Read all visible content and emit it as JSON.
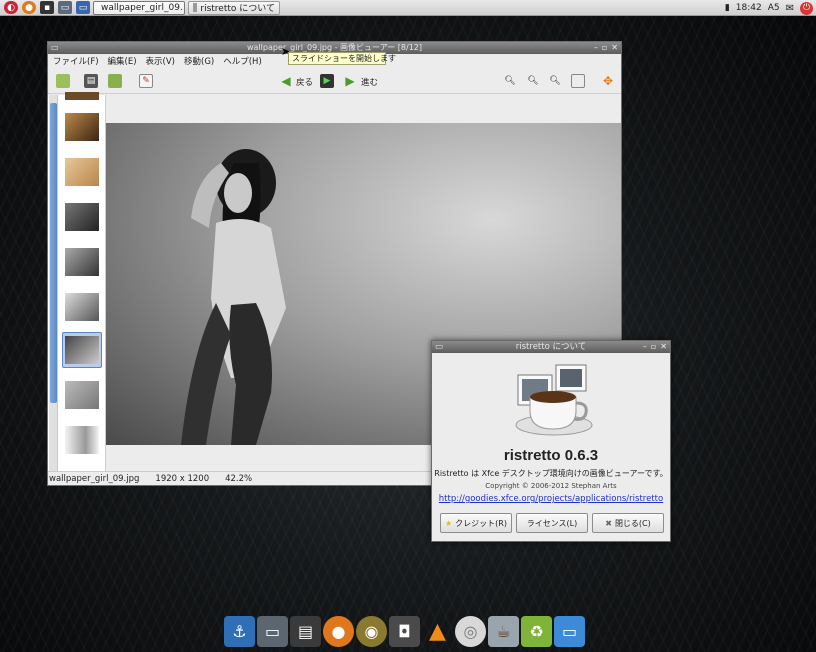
{
  "top_panel": {
    "tasks": [
      {
        "label": "wallpaper_girl_09…"
      },
      {
        "label": "ristretto について"
      }
    ],
    "clock": "18:42",
    "ime": "A5"
  },
  "viewer": {
    "title": "wallpaper_girl_09.jpg - 画像ビューアー [8/12]",
    "menu": [
      "ファイル(F)",
      "編集(E)",
      "表示(V)",
      "移動(G)",
      "ヘルプ(H)"
    ],
    "toolbar": {
      "back": "戻る",
      "forward": "進む"
    },
    "tooltip": "スライドショーを開始します",
    "status": {
      "filename": "wallpaper_girl_09.jpg",
      "dimensions": "1920 x 1200",
      "zoom": "42.2%"
    }
  },
  "about": {
    "title": "ristretto について",
    "app_name": "ristretto 0.6.3",
    "description": "Ristretto は Xfce デスクトップ環境向けの画像ビューアーです。",
    "copyright": "Copyright © 2006-2012 Stephan Arts",
    "link": "http://goodies.xfce.org/projects/applications/ristretto",
    "buttons": {
      "credits": "クレジット(R)",
      "license": "ライセンス(L)",
      "close": "閉じる(C)"
    }
  },
  "colors": {
    "selection": "#b8cdee",
    "link": "#1a33cc",
    "tooltip_bg": "#ffffcc"
  }
}
